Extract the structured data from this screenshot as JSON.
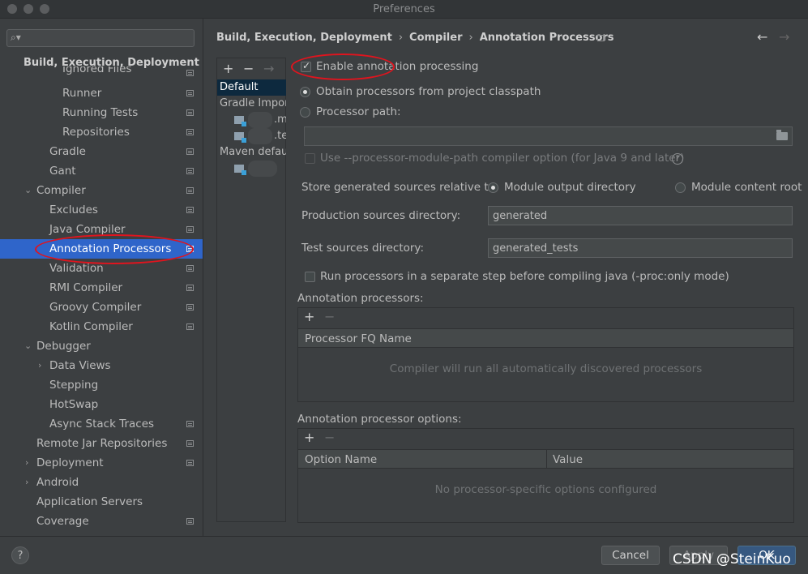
{
  "window": {
    "title": "Preferences"
  },
  "sidebar": {
    "search_placeholder": "",
    "section_title": "Build, Execution, Deployment",
    "items": [
      {
        "label": "Ignored Files"
      },
      {
        "label": "Runner"
      },
      {
        "label": "Running Tests"
      },
      {
        "label": "Repositories"
      },
      {
        "label": "Gradle"
      },
      {
        "label": "Gant"
      },
      {
        "label": "Compiler"
      },
      {
        "label": "Excludes"
      },
      {
        "label": "Java Compiler"
      },
      {
        "label": "Annotation Processors"
      },
      {
        "label": "Validation"
      },
      {
        "label": "RMI Compiler"
      },
      {
        "label": "Groovy Compiler"
      },
      {
        "label": "Kotlin Compiler"
      },
      {
        "label": "Debugger"
      },
      {
        "label": "Data Views"
      },
      {
        "label": "Stepping"
      },
      {
        "label": "HotSwap"
      },
      {
        "label": "Async Stack Traces"
      },
      {
        "label": "Remote Jar Repositories"
      },
      {
        "label": "Deployment"
      },
      {
        "label": "Android"
      },
      {
        "label": "Application Servers"
      },
      {
        "label": "Coverage"
      }
    ]
  },
  "breadcrumb": {
    "part1": "Build, Execution, Deployment",
    "part2": "Compiler",
    "part3": "Annotation Processors",
    "separator": "›"
  },
  "profiles": {
    "items": [
      {
        "label": "Default"
      },
      {
        "label": "Gradle Impor"
      },
      {
        "label": ".m"
      },
      {
        "label": ".te"
      },
      {
        "label": "Maven defaul"
      }
    ]
  },
  "form": {
    "enable_annotation_processing": "Enable annotation processing",
    "obtain_from_classpath": "Obtain processors from project classpath",
    "processor_path": "Processor path:",
    "processor_path_value": "",
    "use_module_path": "Use --processor-module-path compiler option (for Java 9 and later)",
    "store_generated_label": "Store generated sources relative to:",
    "module_output_directory": "Module output directory",
    "module_content_root": "Module content root",
    "production_sources_label": "Production sources directory:",
    "production_sources_value": "generated",
    "test_sources_label": "Test sources directory:",
    "test_sources_value": "generated_tests",
    "run_separate_step": "Run processors in a separate step before compiling java (-proc:only mode)",
    "annotation_processors_title": "Annotation processors:",
    "processor_fq_name_header": "Processor FQ Name",
    "processors_empty": "Compiler will run all automatically discovered processors",
    "options_title": "Annotation processor options:",
    "option_name_header": "Option Name",
    "value_header": "Value",
    "options_empty": "No processor-specific options configured"
  },
  "footer": {
    "help": "?",
    "cancel": "Cancel",
    "apply": "Apply",
    "ok": "OK",
    "watermark": "CSDN @SteinKuo"
  },
  "colors": {
    "background": "#3c3f41",
    "selection": "#2f65ca",
    "annotation_ring": "#e0141e"
  }
}
